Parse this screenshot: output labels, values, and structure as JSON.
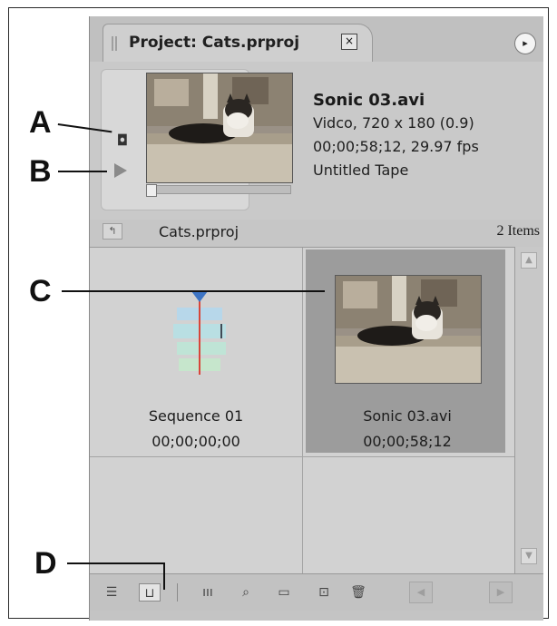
{
  "panel": {
    "tab_title": "Project: Cats.prproj",
    "close_glyph": "×",
    "menu_glyph": "▸"
  },
  "preview": {
    "clip_name": "Sonic 03.avi",
    "info_lines": [
      "Vidco, 720 x 180 (0.9)",
      "00;00;58;12, 29.97 fps",
      "Untitled Tape"
    ],
    "icons": {
      "poster_frame": "camera-icon",
      "play": "play-icon"
    }
  },
  "path_bar": {
    "up_glyph": "↰",
    "project_name": "Cats.prproj",
    "item_count": "2 Items"
  },
  "items": [
    {
      "name": "Sequence 01",
      "duration": "00;00;00;00",
      "kind": "sequence",
      "selected": false
    },
    {
      "name": "Sonic 03.avi",
      "duration": "00;00;58;12",
      "kind": "clip",
      "selected": true
    }
  ],
  "toolbar": {
    "list_view_glyph": "☰",
    "icon_view_glyph": "⊔",
    "automate_glyph": "ııı",
    "find_glyph": "⌕",
    "new_bin_glyph": "▭",
    "new_item_glyph": "⊡",
    "clear_glyph": "🗑",
    "left_glyph": "◀",
    "right_glyph": "▶"
  },
  "scroll": {
    "up_glyph": "▲",
    "down_glyph": "▼"
  },
  "callouts": [
    "A",
    "B",
    "C",
    "D"
  ]
}
